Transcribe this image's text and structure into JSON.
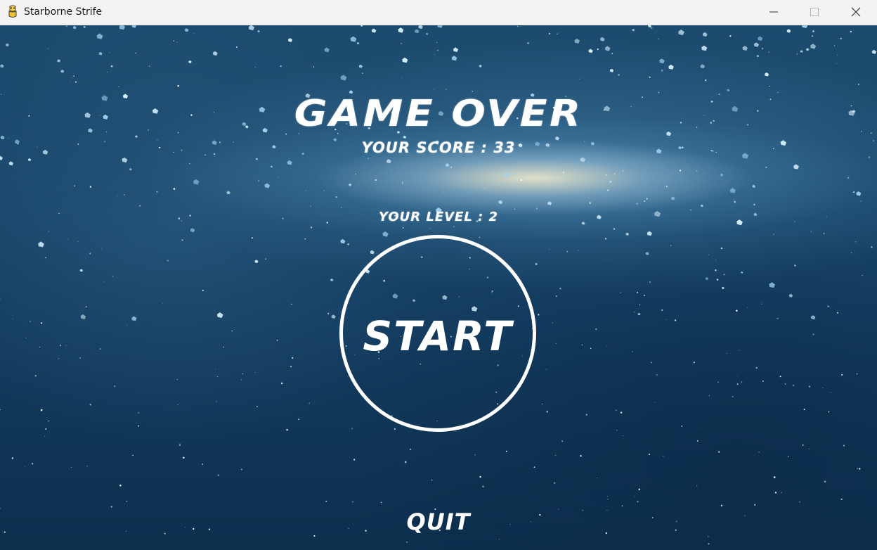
{
  "window": {
    "title": "Starborne Strife",
    "icon": "python-snake-icon",
    "controls": [
      "minimize-icon",
      "maximize-icon",
      "close-icon"
    ]
  },
  "game": {
    "heading": "GAME OVER",
    "score_text": "YOUR SCORE : 33",
    "level_text": "YOUR LEVEL : 2",
    "start_label": "START",
    "quit_label": "QUIT"
  },
  "colors": {
    "text": "#ffffff",
    "titlebar": "#f3f3f3",
    "background_space": "#184468"
  }
}
